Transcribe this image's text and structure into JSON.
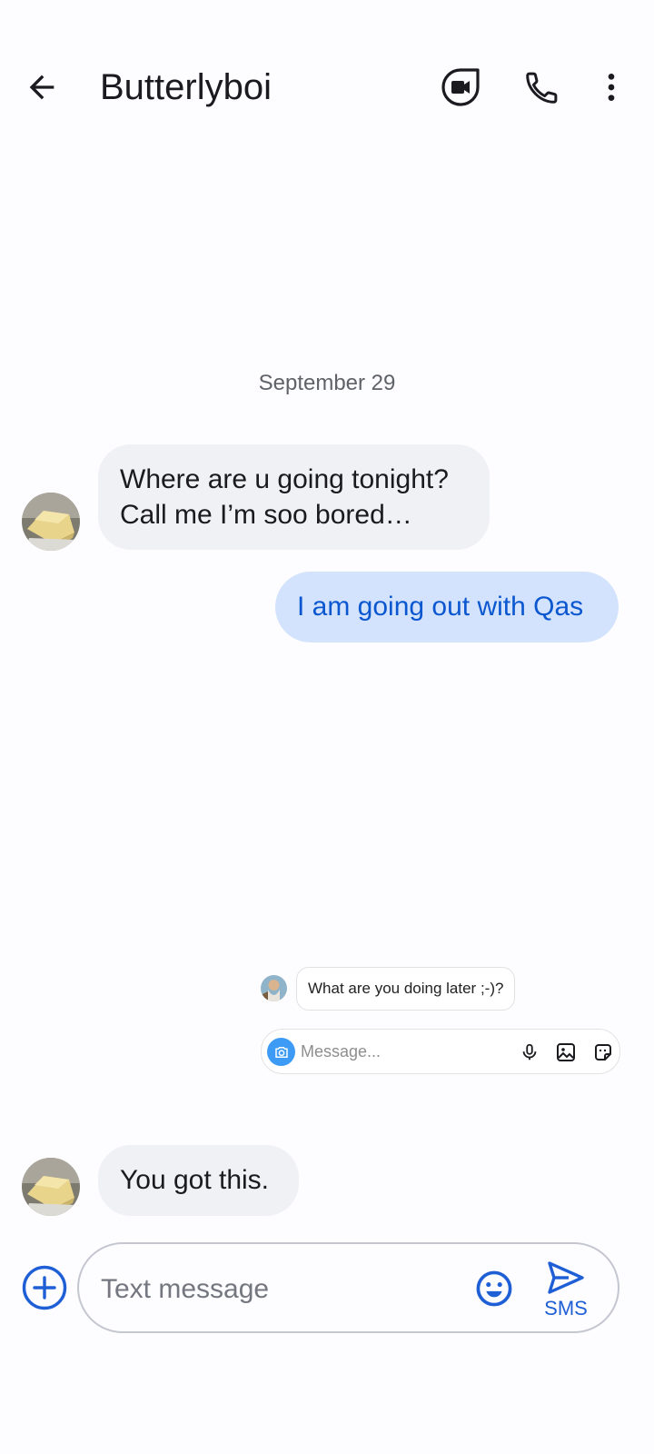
{
  "header": {
    "title": "Butterlyboi",
    "back_icon": "arrow-back-icon",
    "video_icon": "video-call-icon",
    "call_icon": "phone-icon",
    "more_icon": "more-vert-icon"
  },
  "conversation": {
    "date_separator": "September 29",
    "messages": [
      {
        "direction": "incoming",
        "line1": "Where are u going tonight?",
        "line2": "Call me I’m soo bored…"
      },
      {
        "direction": "outgoing",
        "text": "I am going out with Qas"
      },
      {
        "direction": "incoming",
        "text": "You got this."
      }
    ],
    "embedded_card": {
      "message": "What are you doing later ;-)?",
      "input_placeholder": "Message..."
    }
  },
  "compose": {
    "placeholder": "Text message",
    "send_label": "SMS"
  },
  "colors": {
    "accent": "#1f5fd6",
    "incoming_bubble": "#f0f1f4",
    "outgoing_bubble": "#d3e3fd",
    "outgoing_text": "#0b57d0"
  }
}
